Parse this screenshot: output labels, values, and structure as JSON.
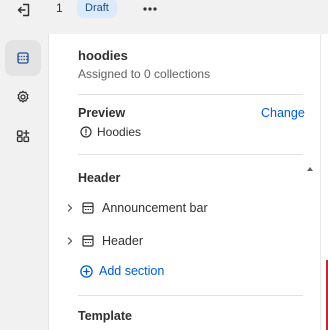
{
  "topbar": {
    "exit_icon": "exit-icon",
    "count": "1",
    "status_badge": "Draft",
    "more_icon": "more-horizontal-icon"
  },
  "rail": {
    "items": [
      {
        "icon": "sections-icon",
        "active": true
      },
      {
        "icon": "settings-gear-icon",
        "active": false
      },
      {
        "icon": "app-blocks-icon",
        "active": false
      }
    ]
  },
  "panel": {
    "title": "hoodies",
    "subtitle": "Assigned to 0 collections",
    "preview": {
      "label": "Preview",
      "change_label": "Change",
      "value": "Hoodies",
      "value_icon": "info-circle-icon"
    },
    "header_group": {
      "label": "Header",
      "items": [
        {
          "label": "Announcement bar",
          "icon": "section-icon"
        },
        {
          "label": "Header",
          "icon": "section-icon"
        }
      ],
      "add_label": "Add section"
    },
    "template_label": "Template"
  },
  "colors": {
    "accent": "#005bd3",
    "badge_bg": "#dbeafd",
    "chrome_bg": "#f1f1f1"
  }
}
